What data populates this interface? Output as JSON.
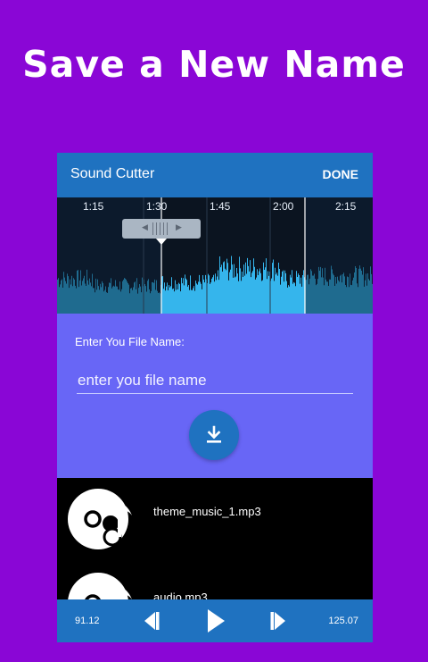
{
  "promo": {
    "title": "Save a New Name"
  },
  "app_bar": {
    "title": "Sound Cutter",
    "done_label": "DONE"
  },
  "waveform": {
    "time_ticks": [
      "1:15",
      "1:30",
      "1:45",
      "2:00",
      "2:15"
    ]
  },
  "form": {
    "label": "Enter You File Name:",
    "input_value": "",
    "input_placeholder": "enter you file name"
  },
  "files": [
    {
      "name": "theme_music_1.mp3",
      "icon": "music-disc-icon"
    },
    {
      "name": "audio.mp3",
      "icon": "music-disc-icon"
    }
  ],
  "player": {
    "start_time": "91.12",
    "end_time": "125.07"
  },
  "colors": {
    "page_bg": "#8a06d6",
    "app_bar": "#1f72c0",
    "form_bg": "#6866f6",
    "wave_selected": "#35b5ec",
    "wave_unselected": "#1f6b8f"
  }
}
